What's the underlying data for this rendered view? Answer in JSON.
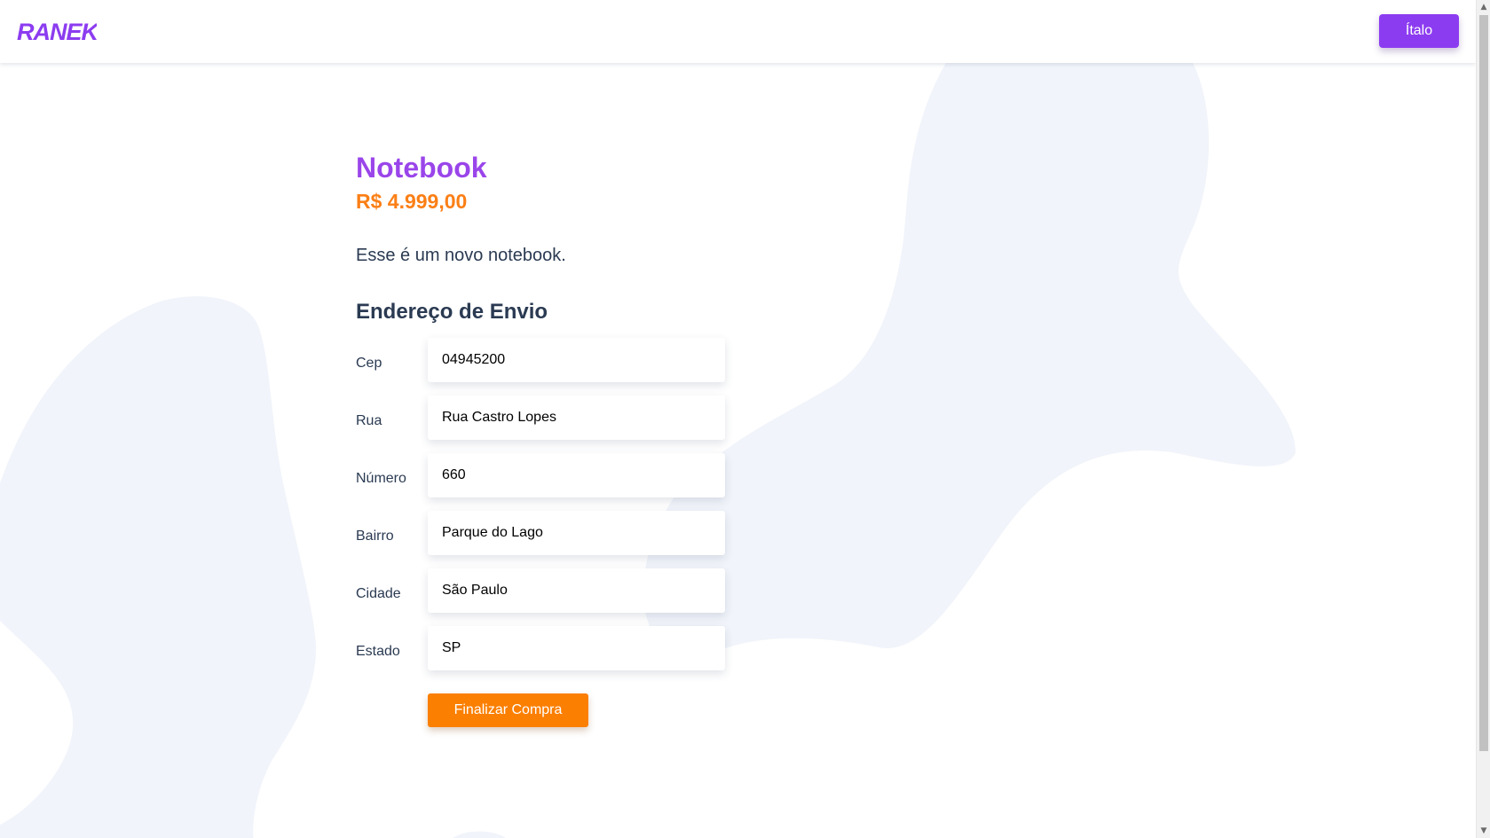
{
  "header": {
    "logo_text": "RANEK",
    "user_button_label": "Ítalo"
  },
  "product": {
    "title": "Notebook",
    "price": "R$ 4.999,00",
    "description": "Esse é um novo notebook."
  },
  "shipping": {
    "section_title": "Endereço de Envio",
    "fields": [
      {
        "label": "Cep",
        "value": "04945200"
      },
      {
        "label": "Rua",
        "value": "Rua Castro Lopes"
      },
      {
        "label": "Número",
        "value": "660"
      },
      {
        "label": "Bairro",
        "value": "Parque do Lago"
      },
      {
        "label": "Cidade",
        "value": "São Paulo"
      },
      {
        "label": "Estado",
        "value": "SP"
      }
    ],
    "submit_label": "Finalizar Compra"
  },
  "colors": {
    "brand_purple": "#8c3cf0",
    "title_purple": "#9a45ea",
    "price_orange": "#fb7f16",
    "button_orange": "#fb7f00",
    "text_dark": "#2a3a52",
    "blob_bg": "#f1f4fa"
  },
  "icons": {
    "scroll_up": "scroll-up-arrow-icon",
    "scroll_down": "scroll-down-arrow-icon"
  }
}
